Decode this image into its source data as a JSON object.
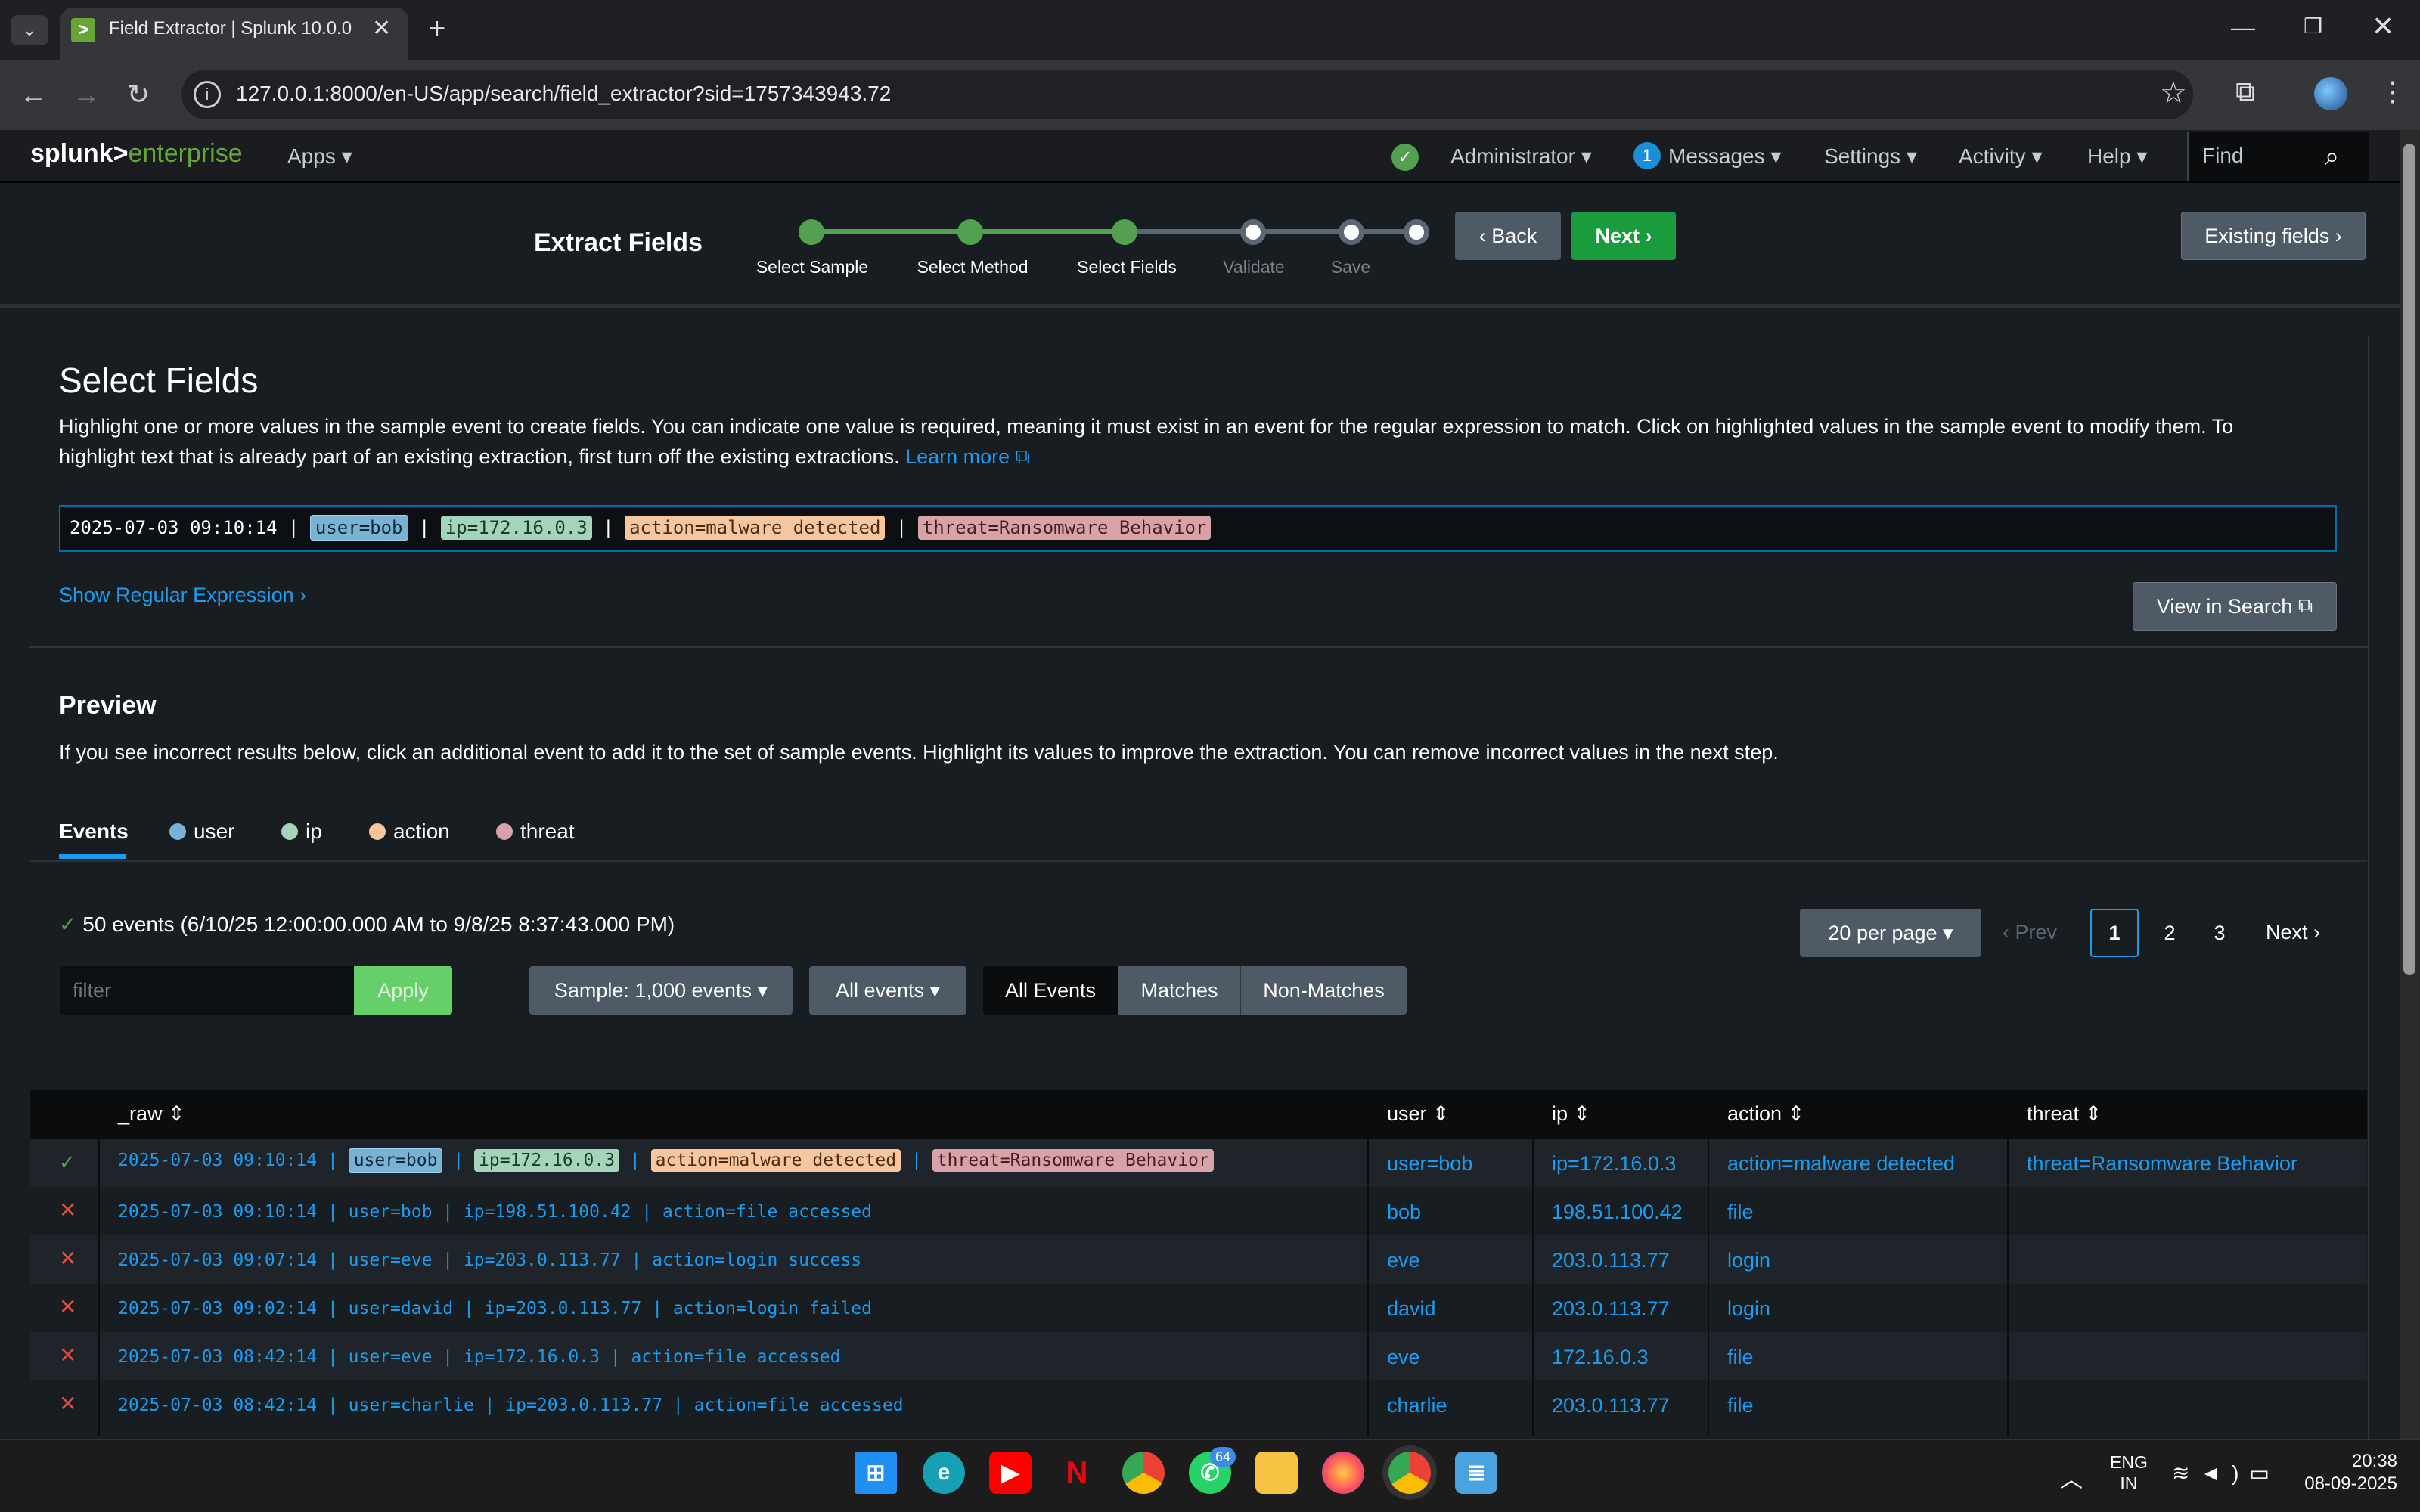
{
  "browser": {
    "tab_title": "Field Extractor | Splunk 10.0.0",
    "url": "127.0.0.1:8000/en-US/app/search/field_extractor?sid=1757343943.72"
  },
  "splunk_nav": {
    "logo_a": "splunk>",
    "logo_b": "enterprise",
    "apps": "Apps",
    "administrator": "Administrator",
    "messages_count": "1",
    "messages": "Messages",
    "settings": "Settings",
    "activity": "Activity",
    "help": "Help",
    "find": "Find"
  },
  "wizard": {
    "title": "Extract Fields",
    "steps": [
      "Select Sample",
      "Select Method",
      "Select Fields",
      "Validate",
      "Save"
    ],
    "back": "Back",
    "next": "Next",
    "existing_fields": "Existing fields"
  },
  "select_fields": {
    "title": "Select Fields",
    "description": "Highlight one or more values in the sample event to create fields. You can indicate one value is required, meaning it must exist in an event for the regular expression to match. Click on highlighted values in the sample event to modify them. To highlight text that is already part of an existing extraction, first turn off the existing extractions.",
    "learn_more": "Learn more",
    "sample": {
      "timestamp": "2025-07-03 09:10:14",
      "sep": "|",
      "user": "user=bob",
      "ip": "ip=172.16.0.3",
      "action": "action=malware detected",
      "threat": "threat=Ransomware Behavior"
    },
    "show_regex": "Show Regular Expression",
    "view_in_search": "View in Search"
  },
  "preview": {
    "title": "Preview",
    "description": "If you see incorrect results below, click an additional event to add it to the set of sample events. Highlight its values to improve the extraction. You can remove incorrect values in the next step.",
    "tabs": [
      "Events",
      "user",
      "ip",
      "action",
      "threat"
    ],
    "tab_colors": {
      "user": "#7ab2d4",
      "ip": "#a4d4bb",
      "action": "#f7c69e",
      "threat": "#d8a3a8"
    },
    "events_count": "50 events (6/10/25 12:00:00.000 AM to 9/8/25 8:37:43.000 PM)",
    "per_page": "20 per page",
    "prev": "Prev",
    "pages": [
      "1",
      "2",
      "3"
    ],
    "next": "Next",
    "filter_placeholder": "filter",
    "apply": "Apply",
    "sample_dd": "Sample: 1,000 events",
    "all_events_dd": "All events",
    "segments": [
      "All Events",
      "Matches",
      "Non-Matches"
    ]
  },
  "table": {
    "headers": [
      "_raw",
      "user",
      "ip",
      "action",
      "threat"
    ],
    "first_row": {
      "status": "match",
      "timestamp": "2025-07-03 09:10:14",
      "sep": "|",
      "user_hl": "user=bob",
      "ip_hl": "ip=172.16.0.3",
      "action_hl": "action=malware detected",
      "threat_hl": "threat=Ransomware Behavior",
      "user": "user=bob",
      "ip": "ip=172.16.0.3",
      "action": "action=malware detected",
      "threat": "threat=Ransomware Behavior"
    },
    "rows": [
      {
        "raw": "2025-07-03 09:10:14 | user=bob | ip=198.51.100.42 | action=file accessed",
        "user": "bob",
        "ip": "198.51.100.42",
        "action": "file",
        "threat": ""
      },
      {
        "raw": "2025-07-03 09:07:14 | user=eve | ip=203.0.113.77 | action=login success",
        "user": "eve",
        "ip": "203.0.113.77",
        "action": "login",
        "threat": ""
      },
      {
        "raw": "2025-07-03 09:02:14 | user=david | ip=203.0.113.77 | action=login failed",
        "user": "david",
        "ip": "203.0.113.77",
        "action": "login",
        "threat": ""
      },
      {
        "raw": "2025-07-03 08:42:14 | user=eve | ip=172.16.0.3 | action=file accessed",
        "user": "eve",
        "ip": "172.16.0.3",
        "action": "file",
        "threat": ""
      },
      {
        "raw": "2025-07-03 08:42:14 | user=charlie | ip=203.0.113.77 | action=file accessed",
        "user": "charlie",
        "ip": "203.0.113.77",
        "action": "file",
        "threat": ""
      }
    ]
  },
  "taskbar": {
    "badge": "64",
    "lang_1": "ENG",
    "lang_2": "IN",
    "time": "20:38",
    "date": "08-09-2025"
  }
}
